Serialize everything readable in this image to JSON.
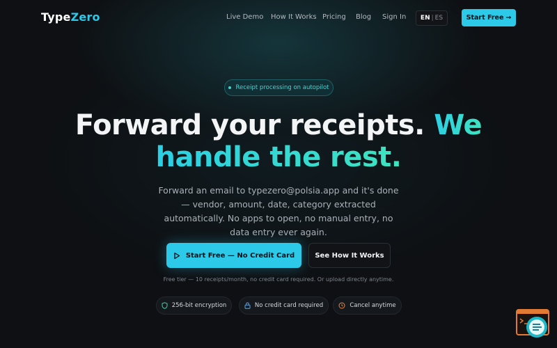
{
  "nav": {
    "logo_type": "Type",
    "logo_zero": "Zero",
    "links": [
      "Live Demo",
      "How It Works",
      "Pricing",
      "Blog",
      "Sign In"
    ],
    "lang_en": "EN",
    "lang_sep": "|",
    "lang_es": "ES",
    "cta_label": "Start Free",
    "cta_arrow": "→"
  },
  "hero": {
    "pill": "Receipt processing on autopilot",
    "headline_plain": "Forward your receipts. ",
    "headline_accent_1": "We",
    "headline_accent_2": "handle the rest.",
    "subtext": "Forward an email to typezero@polsia.app and it's done — vendor, amount, date, category extracted automatically. No apps to open, no manual entry, no data entry ever again.",
    "primary_button": "Start Free — No Credit Card",
    "secondary_button": "See How It Works",
    "note": "Free tier — 10 receipts/month, no credit card required. Or upload directly anytime."
  },
  "badges": [
    {
      "label": "256-bit encryption",
      "icon": "shield-icon"
    },
    {
      "label": "No credit card required",
      "icon": "lock-icon"
    },
    {
      "label": "Cancel anytime",
      "icon": "clock-icon"
    }
  ],
  "colors": {
    "accent": "#2cc9e8",
    "accent_green": "#3ee3c0",
    "background": "#0e1013"
  }
}
